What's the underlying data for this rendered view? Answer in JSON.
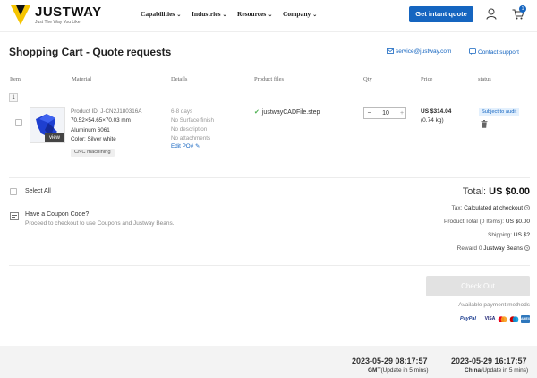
{
  "brand": {
    "name": "JUSTWAY",
    "tagline": "Just The Way You Like",
    "accent": "#1565c0",
    "logo_color": "#f5c400"
  },
  "nav": {
    "items": [
      {
        "label": "Capabilities"
      },
      {
        "label": "Industries"
      },
      {
        "label": "Resources"
      },
      {
        "label": "Company"
      }
    ],
    "quote_button": "Get intant quote",
    "cart_count": "1"
  },
  "page": {
    "title": "Shopping Cart - Quote requests",
    "email": "service@justway.com",
    "support": "Contact support"
  },
  "table": {
    "headers": {
      "item": "Item",
      "material": "Material",
      "details": "Details",
      "files": "Product files",
      "qty": "Qty",
      "price": "Price",
      "status": "status"
    },
    "group": "1",
    "row": {
      "thumb_label": "view",
      "product_id": "Product ID: J-CN2J180316A",
      "dimensions": "70.52×54.65×70.03 mm",
      "material": "Aluminum 6061",
      "color": "Color: Silver white",
      "process": "CNC machining",
      "lead_time": "6-8 days",
      "finish": "No Surface finish",
      "description": "No description",
      "attachments": "No attachments",
      "edit_po": "Edit PO#",
      "file": "justwayCADFile.step",
      "qty": "10",
      "qty_minus": "−",
      "qty_plus": "+",
      "price": "US $314.04",
      "weight": "(0.74 kg)",
      "status": "Subject to audit"
    }
  },
  "summary": {
    "select_all": "Select All",
    "total_label": "Total:",
    "total_value": "US $0.00",
    "coupon_title": "Have a Coupon Code?",
    "coupon_sub": "Proceed to checkout to use Coupons and Justway Beans.",
    "tax_label": "Tax:",
    "tax_value": "Calculated at checkout",
    "product_total_label": "Product Total (0 Items):",
    "product_total_value": "US $0.00",
    "shipping_label": "Shipping:",
    "shipping_value": "US $?",
    "reward_label": "Reward",
    "reward_value": "0",
    "reward_unit": "Justway Beans",
    "checkout": "Check Out",
    "payment_label": "Available payment methods",
    "payment_methods": [
      "PayPal",
      "VISA",
      "MC",
      "MC",
      "AMEX"
    ]
  },
  "footer": {
    "gmt_time": "2023-05-29 08:17:57",
    "gmt_zone": "GMT",
    "gmt_note": "(Update in 5 mins)",
    "china_time": "2023-05-29 16:17:57",
    "china_zone": "China",
    "china_note": "(Update in 5 mins)"
  }
}
